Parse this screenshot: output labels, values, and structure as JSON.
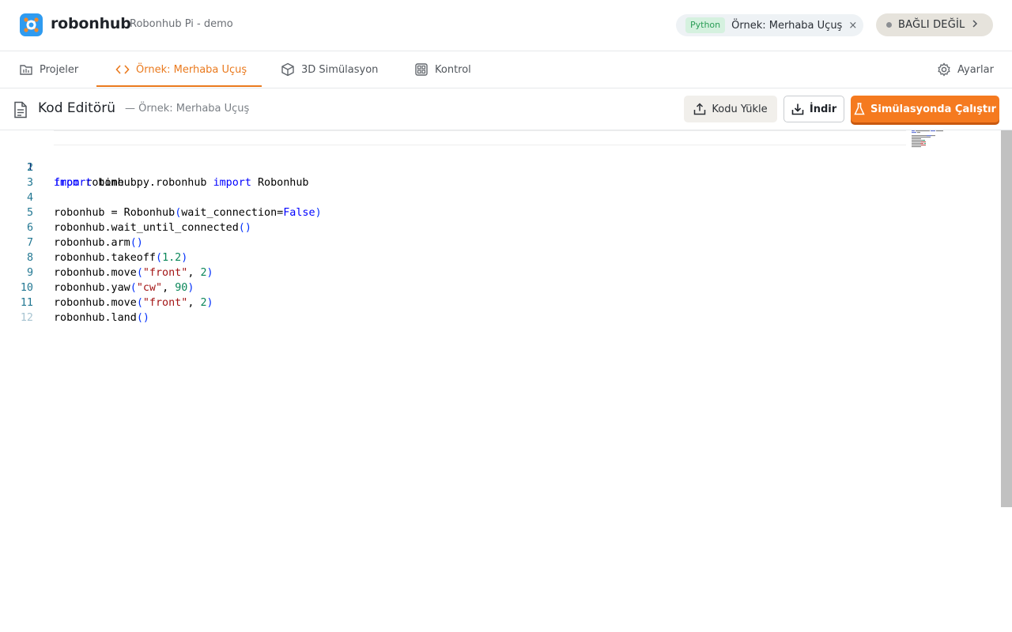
{
  "app": {
    "brand": "robonhub",
    "subtitle": "Robonhub Pi - demo"
  },
  "file_pill": {
    "language": "Python",
    "file_name": "Örnek: Merhaba Uçuş",
    "close_glyph": "×"
  },
  "connection": {
    "status": "BAĞLI DEĞİL",
    "dot_color": "#8c8f93"
  },
  "tabs": [
    {
      "label": "Projeler",
      "icon": "folder-icon"
    },
    {
      "label": "Örnek: Merhaba Uçuş",
      "icon": "code-icon",
      "active": true
    },
    {
      "label": "3D Simülasyon",
      "icon": "cube-icon"
    },
    {
      "label": "Kontrol",
      "icon": "gamepad-icon"
    }
  ],
  "settings": {
    "label": "Ayarlar",
    "icon": "gear-icon"
  },
  "editor": {
    "title": "Kod Editörü",
    "subtitle": "— Örnek: Merhaba Uçuş",
    "upload_label": "Kodu Yükle",
    "download_label": "İndir",
    "run_label": "Simülasyonda Çalıştır",
    "lines": [
      "from robonhubpy.robonhub import Robonhub",
      "import time",
      "",
      "robonhub = Robonhub(wait_connection=False)",
      "robonhub.wait_until_connected()",
      "robonhub.arm()",
      "robonhub.takeoff(1.2)",
      "robonhub.move(\"front\", 2)",
      "robonhub.yaw(\"cw\", 90)",
      "robonhub.move(\"front\", 2)",
      "robonhub.land()",
      ""
    ],
    "line_numbers": [
      "1",
      "2",
      "3",
      "4",
      "5",
      "6",
      "7",
      "8",
      "9",
      "10",
      "11",
      "12"
    ]
  },
  "colors": {
    "accent": "#ea7a1e",
    "run_button": "#f57a1f",
    "logo": "#2f9bf0",
    "language_badge_bg": "#d5f1df",
    "language_badge_text": "#2a9d56"
  }
}
